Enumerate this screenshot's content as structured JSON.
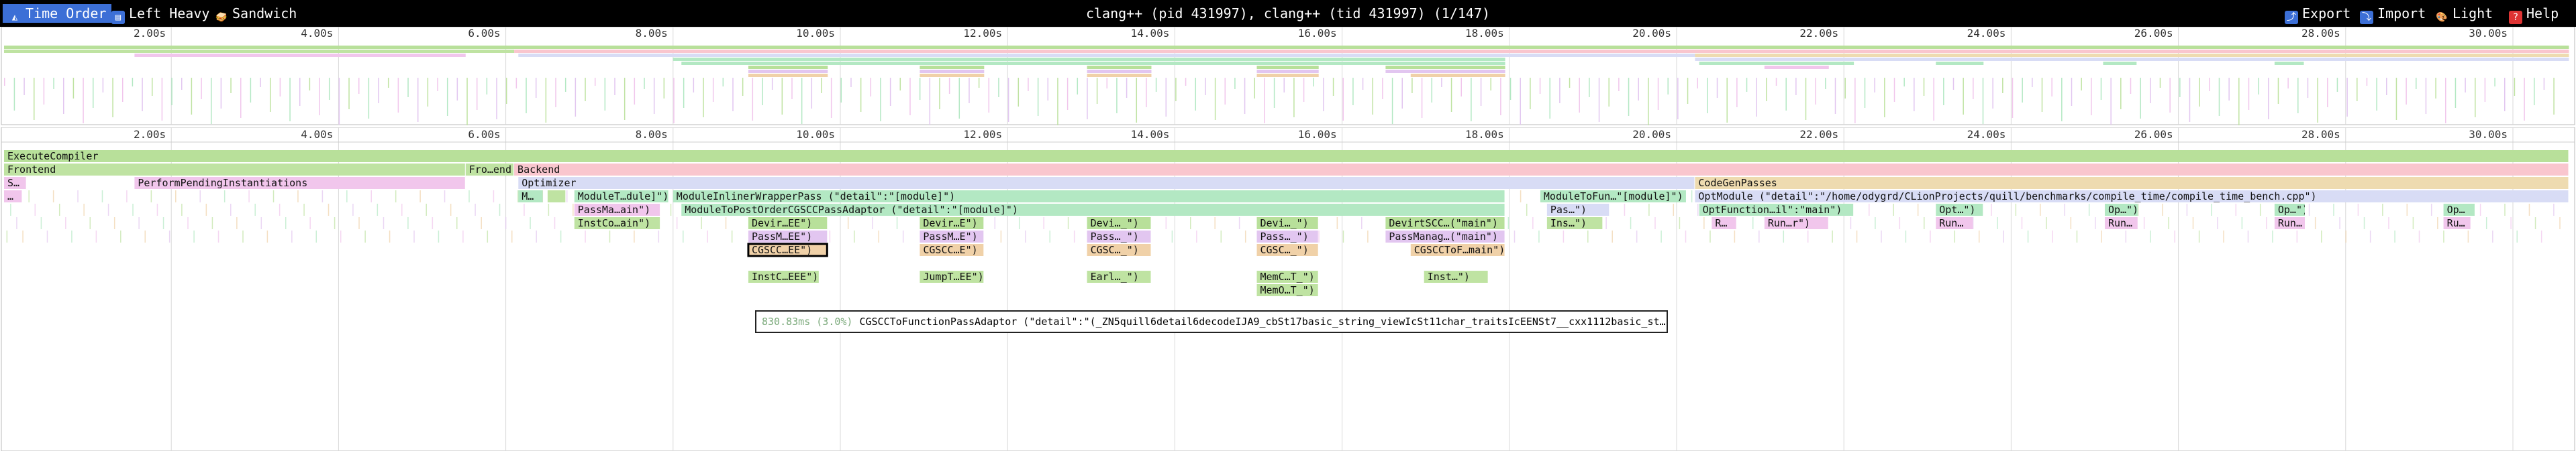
{
  "toolbar": {
    "tabs": [
      {
        "label": "Time Order",
        "icon": "triangle-chart-icon",
        "active": true
      },
      {
        "label": "Left Heavy",
        "icon": "left-heavy-icon",
        "active": false
      },
      {
        "label": "Sandwich",
        "icon": "sandwich-icon",
        "active": false
      }
    ],
    "title": "clang++ (pid 431997), clang++ (tid 431997) (1/147)",
    "actions": [
      {
        "label": "Export",
        "icon": "export-icon"
      },
      {
        "label": "Import",
        "icon": "import-icon"
      },
      {
        "label": "Light",
        "icon": "light-theme-icon"
      },
      {
        "label": "Help",
        "icon": "help-icon"
      }
    ]
  },
  "colors": {
    "toolbar_bg": "#000000",
    "active_tab": "#3c6fd6",
    "execute": "#b8e09a",
    "frontend": "#bfe3a2",
    "backend": "#f9c6ce",
    "optimizer": "#d8dcf5",
    "codegen": "#eedbb0",
    "inliner": "#b3e8c3",
    "pink": "#f1c6ec",
    "lavender": "#e2c6f0",
    "tan": "#f0d1a8",
    "selection_border": "#000000"
  },
  "timeline": {
    "ticks": [
      "2.00s",
      "4.00s",
      "6.00s",
      "8.00s",
      "10.00s",
      "12.00s",
      "14.00s",
      "16.00s",
      "18.00s",
      "20.00s",
      "22.00s",
      "24.00s",
      "26.00s",
      "28.00s",
      "30.00s"
    ]
  },
  "frames": [
    {
      "label": "ExecuteCompiler",
      "start": 0.0,
      "end": 30.67,
      "depth": 0,
      "color": "execute"
    },
    {
      "label": "Frontend",
      "start": 0.0,
      "end": 5.52,
      "depth": 1,
      "color": "frontend"
    },
    {
      "label": "Fro…end",
      "start": 5.52,
      "end": 6.1,
      "depth": 1,
      "color": "frontend"
    },
    {
      "label": "Backend",
      "start": 6.1,
      "end": 30.67,
      "depth": 1,
      "color": "backend"
    },
    {
      "label": "S…",
      "start": 0.0,
      "end": 0.27,
      "depth": 2,
      "color": "pink"
    },
    {
      "label": "PerformPendingInstantiations",
      "start": 1.56,
      "end": 5.52,
      "depth": 2,
      "color": "pink"
    },
    {
      "label": "Optimizer",
      "start": 6.15,
      "end": 20.22,
      "depth": 2,
      "color": "optimizer"
    },
    {
      "label": "CodeGenPasses",
      "start": 20.22,
      "end": 30.67,
      "depth": 2,
      "color": "codegen"
    },
    {
      "label": "…",
      "start": 0.0,
      "end": 0.22,
      "depth": 3,
      "color": "pink"
    },
    {
      "label": "M…",
      "start": 6.15,
      "end": 6.45,
      "depth": 3,
      "color": "inliner"
    },
    {
      "label": "",
      "start": 6.5,
      "end": 6.72,
      "depth": 3,
      "color": "frontend"
    },
    {
      "label": "ModuleT…dule]\")",
      "start": 6.82,
      "end": 7.95,
      "depth": 3,
      "color": "inliner"
    },
    {
      "label": "ModuleInlinerWrapperPass (\"detail\":\"[module]\")",
      "start": 8.0,
      "end": 17.95,
      "depth": 3,
      "color": "inliner"
    },
    {
      "label": "ModuleToFun…\"[module]\")",
      "start": 18.37,
      "end": 20.12,
      "depth": 3,
      "color": "inliner"
    },
    {
      "label": "OptModule (\"detail\":\"/home/odygrd/CLionProjects/quill/benchmarks/compile_time/compile_time_bench.cpp\")",
      "start": 20.22,
      "end": 30.67,
      "depth": 3,
      "color": "optimizer"
    },
    {
      "label": "PassMa…ain\")",
      "start": 6.82,
      "end": 7.85,
      "depth": 4,
      "color": "pink"
    },
    {
      "label": "ModuleToPostOrderCGSCCPassAdaptor (\"detail\":\"[module]\")",
      "start": 8.1,
      "end": 17.95,
      "depth": 4,
      "color": "inliner"
    },
    {
      "label": "Pas…\")",
      "start": 18.45,
      "end": 19.2,
      "depth": 4,
      "color": "optimizer"
    },
    {
      "label": "OptFunction…il\":\"main\")",
      "start": 20.27,
      "end": 22.12,
      "depth": 4,
      "color": "inliner"
    },
    {
      "label": "Opt…\")",
      "start": 23.1,
      "end": 23.67,
      "depth": 4,
      "color": "inliner"
    },
    {
      "label": "Op…\")",
      "start": 25.12,
      "end": 25.52,
      "depth": 4,
      "color": "inliner"
    },
    {
      "label": "Op…\")",
      "start": 27.15,
      "end": 27.52,
      "depth": 4,
      "color": "inliner"
    },
    {
      "label": "Op…",
      "start": 29.17,
      "end": 29.55,
      "depth": 4,
      "color": "inliner"
    },
    {
      "label": "InstCo…ain\")",
      "start": 6.82,
      "end": 7.85,
      "depth": 5,
      "color": "frontend"
    },
    {
      "label": "Devir…EE\")",
      "start": 8.9,
      "end": 9.85,
      "depth": 5,
      "color": "execute"
    },
    {
      "label": "Devir…E\")",
      "start": 10.95,
      "end": 11.72,
      "depth": 5,
      "color": "execute"
    },
    {
      "label": "Devi…_\")",
      "start": 12.95,
      "end": 13.72,
      "depth": 5,
      "color": "execute"
    },
    {
      "label": "Devi…_\")",
      "start": 14.98,
      "end": 15.72,
      "depth": 5,
      "color": "execute"
    },
    {
      "label": "DevirtSCC…(\"main\")",
      "start": 16.52,
      "end": 17.95,
      "depth": 5,
      "color": "execute"
    },
    {
      "label": "Ins…\")",
      "start": 18.45,
      "end": 19.12,
      "depth": 5,
      "color": "frontend"
    },
    {
      "label": "R…",
      "start": 20.42,
      "end": 20.72,
      "depth": 5,
      "color": "pink"
    },
    {
      "label": "Run…r\")",
      "start": 21.05,
      "end": 21.82,
      "depth": 5,
      "color": "pink"
    },
    {
      "label": "Run…",
      "start": 23.1,
      "end": 23.55,
      "depth": 5,
      "color": "pink"
    },
    {
      "label": "Run…",
      "start": 25.12,
      "end": 25.52,
      "depth": 5,
      "color": "pink"
    },
    {
      "label": "Run…",
      "start": 27.15,
      "end": 27.52,
      "depth": 5,
      "color": "pink"
    },
    {
      "label": "Ru…",
      "start": 29.17,
      "end": 29.5,
      "depth": 5,
      "color": "pink"
    },
    {
      "label": "PassM…EE\")",
      "start": 8.9,
      "end": 9.85,
      "depth": 6,
      "color": "lavender"
    },
    {
      "label": "PassM…E\")",
      "start": 10.95,
      "end": 11.72,
      "depth": 6,
      "color": "lavender"
    },
    {
      "label": "Pass…_\")",
      "start": 12.95,
      "end": 13.72,
      "depth": 6,
      "color": "lavender"
    },
    {
      "label": "Pass…_\")",
      "start": 14.98,
      "end": 15.72,
      "depth": 6,
      "color": "lavender"
    },
    {
      "label": "PassManag…(\"main\")",
      "start": 16.52,
      "end": 17.95,
      "depth": 6,
      "color": "lavender"
    },
    {
      "label": "CGSCC…EE\")",
      "start": 8.9,
      "end": 9.85,
      "depth": 7,
      "color": "tan",
      "selected": true
    },
    {
      "label": "CGSCC…E\")",
      "start": 10.95,
      "end": 11.72,
      "depth": 7,
      "color": "tan"
    },
    {
      "label": "CGSC…_\")",
      "start": 12.95,
      "end": 13.72,
      "depth": 7,
      "color": "tan"
    },
    {
      "label": "CGSC…_\")",
      "start": 14.98,
      "end": 15.72,
      "depth": 7,
      "color": "tan"
    },
    {
      "label": "CGSCCToF…main\")",
      "start": 16.82,
      "end": 17.95,
      "depth": 7,
      "color": "tan"
    },
    {
      "label": "InstC…EEE\")",
      "start": 8.9,
      "end": 9.75,
      "depth": 9,
      "color": "frontend"
    },
    {
      "label": "JumpT…EE\")",
      "start": 10.95,
      "end": 11.72,
      "depth": 9,
      "color": "frontend"
    },
    {
      "label": "Earl…_\")",
      "start": 12.95,
      "end": 13.72,
      "depth": 9,
      "color": "frontend"
    },
    {
      "label": "MemC…T_\")",
      "start": 14.98,
      "end": 15.72,
      "depth": 9,
      "color": "frontend"
    },
    {
      "label": "Inst…\")",
      "start": 16.98,
      "end": 17.75,
      "depth": 9,
      "color": "frontend"
    },
    {
      "label": "MemO…T_\")",
      "start": 14.98,
      "end": 15.72,
      "depth": 10,
      "color": "frontend"
    }
  ],
  "tooltip": {
    "duration": "830.83ms (3.0%)",
    "text": "CGSCCToFunctionPassAdaptor (\"detail\":\"(_ZN5quill6detail6decodeIJA9_cbSt17basic_string_viewIcSt11char_traitsIcEENSt7__cxx1112basic_st…"
  }
}
